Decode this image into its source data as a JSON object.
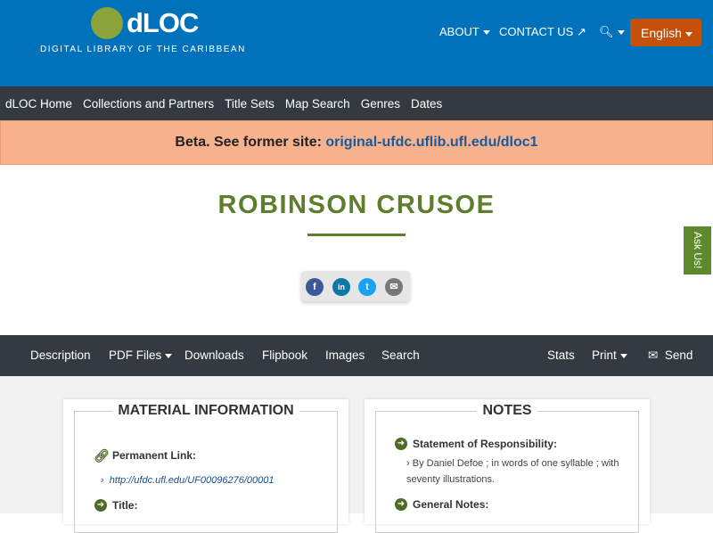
{
  "header": {
    "logo_text": "dLOC",
    "logo_subtitle": "DIGITAL LIBRARY OF THE CARIBBEAN",
    "about": "ABOUT",
    "contact": "CONTACT US",
    "language": "English"
  },
  "nav": [
    "dLOC Home",
    "Collections and Partners",
    "Title Sets",
    "Map Search",
    "Genres",
    "Dates"
  ],
  "beta": {
    "text": "Beta. See former site: ",
    "link": "original-ufdc.uflib.ufl.edu/dloc1"
  },
  "title": "ROBINSON CRUSOE",
  "share": {
    "facebook": "f",
    "linkedin": "in",
    "twitter": "t",
    "email": "✉"
  },
  "ask_us": "Ask Us!",
  "item_nav": {
    "description": "Description",
    "pdf": "PDF Files",
    "downloads": "Downloads",
    "flipbook": "Flipbook",
    "images": "Images",
    "search": "Search",
    "stats": "Stats",
    "print": "Print",
    "send": "Send"
  },
  "material": {
    "heading": "MATERIAL INFORMATION",
    "permalink_label": "Permanent Link:",
    "permalink": "http://ufdc.ufl.edu/UF00096276/00001",
    "title_label": "Title:"
  },
  "notes": {
    "heading": "NOTES",
    "sor_label": "Statement of Responsibility:",
    "sor_value": "By Daniel Defoe ; in words of one syllable ; with seventy illustrations.",
    "general_label": "General Notes:"
  }
}
